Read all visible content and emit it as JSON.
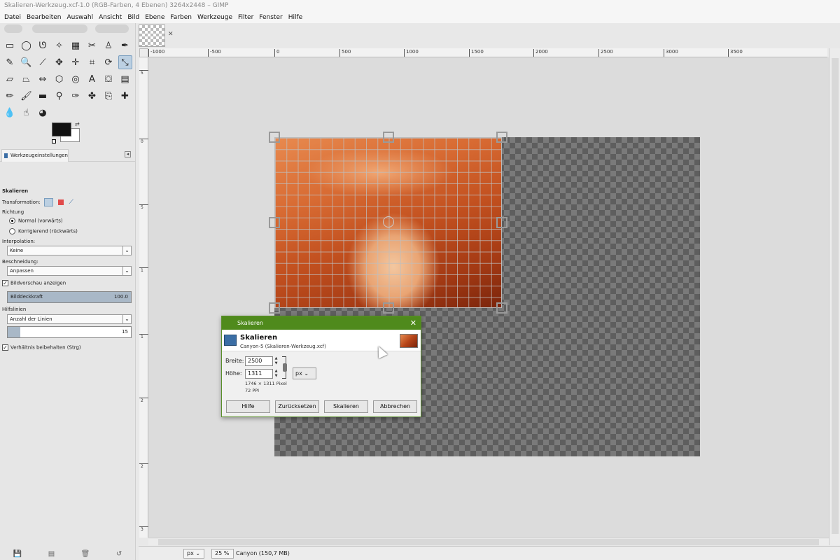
{
  "window": {
    "title": "Skalieren-Werkzeug.xcf-1.0 (RGB-Farben, 4 Ebenen) 3264x2448 – GIMP"
  },
  "menu": [
    "Datei",
    "Bearbeiten",
    "Auswahl",
    "Ansicht",
    "Bild",
    "Ebene",
    "Farben",
    "Werkzeuge",
    "Filter",
    "Fenster",
    "Hilfe"
  ],
  "toolbox": {
    "tools": [
      {
        "name": "rect-select-icon",
        "glyph": "▭"
      },
      {
        "name": "ellipse-select-icon",
        "glyph": "◯"
      },
      {
        "name": "lasso-icon",
        "glyph": "ᘎ"
      },
      {
        "name": "fuzzy-select-icon",
        "glyph": "✧"
      },
      {
        "name": "select-by-color-icon",
        "glyph": "▦"
      },
      {
        "name": "scissors-icon",
        "glyph": "✂"
      },
      {
        "name": "foreground-select-icon",
        "glyph": "♙"
      },
      {
        "name": "paths-icon",
        "glyph": "✒"
      },
      {
        "name": "color-picker-icon",
        "glyph": "✎"
      },
      {
        "name": "zoom-icon",
        "glyph": "🔍"
      },
      {
        "name": "measure-icon",
        "glyph": "⟋"
      },
      {
        "name": "move-icon",
        "glyph": "✥"
      },
      {
        "name": "align-icon",
        "glyph": "✛"
      },
      {
        "name": "crop-icon",
        "glyph": "⌗"
      },
      {
        "name": "rotate-icon",
        "glyph": "⟳"
      },
      {
        "name": "scale-icon",
        "glyph": "⤡",
        "active": true
      },
      {
        "name": "shear-icon",
        "glyph": "▱"
      },
      {
        "name": "perspective-icon",
        "glyph": "⏢"
      },
      {
        "name": "flip-icon",
        "glyph": "⇔"
      },
      {
        "name": "cage-icon",
        "glyph": "⬡"
      },
      {
        "name": "warp-icon",
        "glyph": "◎"
      },
      {
        "name": "text-icon",
        "glyph": "A"
      },
      {
        "name": "bucket-fill-icon",
        "glyph": "⛋"
      },
      {
        "name": "blend-icon",
        "glyph": "▤"
      },
      {
        "name": "pencil-icon",
        "glyph": "✏"
      },
      {
        "name": "paintbrush-icon",
        "glyph": "🖌"
      },
      {
        "name": "eraser-icon",
        "glyph": "▬"
      },
      {
        "name": "airbrush-icon",
        "glyph": "⚲"
      },
      {
        "name": "ink-icon",
        "glyph": "✑"
      },
      {
        "name": "mypaint-brush-icon",
        "glyph": "✤"
      },
      {
        "name": "clone-icon",
        "glyph": "⎘"
      },
      {
        "name": "heal-icon",
        "glyph": "✚"
      },
      {
        "name": "blur-icon",
        "glyph": "💧"
      },
      {
        "name": "smudge-icon",
        "glyph": "☝"
      },
      {
        "name": "dodge-burn-icon",
        "glyph": "◕"
      }
    ],
    "colors": {
      "foreground": "#111111",
      "background": "#ffffff"
    },
    "panel_tab": "Werkzeugeinstellungen",
    "options": {
      "tool_title": "Skalieren",
      "transformation_label": "Transformation:",
      "direction_label": "Richtung",
      "direction_normal": "Normal (vorwärts)",
      "direction_corrective": "Korrigierend (rückwärts)",
      "interpolation_label": "Interpolation:",
      "interpolation_value": "Keine",
      "clipping_label": "Beschneidung:",
      "clipping_value": "Anpassen",
      "show_preview_label": "Bildvorschau anzeigen",
      "opacity_label": "Bilddeckkraft",
      "opacity_value": "100.0",
      "guides_label": "Hilfslinien",
      "guides_value": "Anzahl der Linien",
      "lines_value": "15",
      "keep_aspect_label": "Verhältnis beibehalten (Strg)"
    }
  },
  "rulers": {
    "horizontal": [
      "-1000",
      "-500",
      "0",
      "500",
      "1000",
      "1500",
      "2000",
      "2500",
      "3000",
      "3500"
    ],
    "vertical": [
      "5",
      "0",
      "5",
      "1",
      "1",
      "2",
      "2",
      "3"
    ]
  },
  "dialog": {
    "title": "Skalieren",
    "heading": "Skalieren",
    "subheading": "Canyon-5 (Skalieren-Werkzeug.xcf)",
    "width_label": "Breite:",
    "width_value": "2500",
    "height_label": "Höhe:",
    "height_value": "1311",
    "unit": "px",
    "size_info": "1746 × 1311 Pixel",
    "ppi_info": "72 PPI",
    "buttons": {
      "help": "Hilfe",
      "reset": "Zurücksetzen",
      "scale": "Skalieren",
      "cancel": "Abbrechen"
    }
  },
  "statusbar": {
    "unit": "px",
    "zoom": "25 %",
    "info": "Canyon (150,7 MB)"
  }
}
